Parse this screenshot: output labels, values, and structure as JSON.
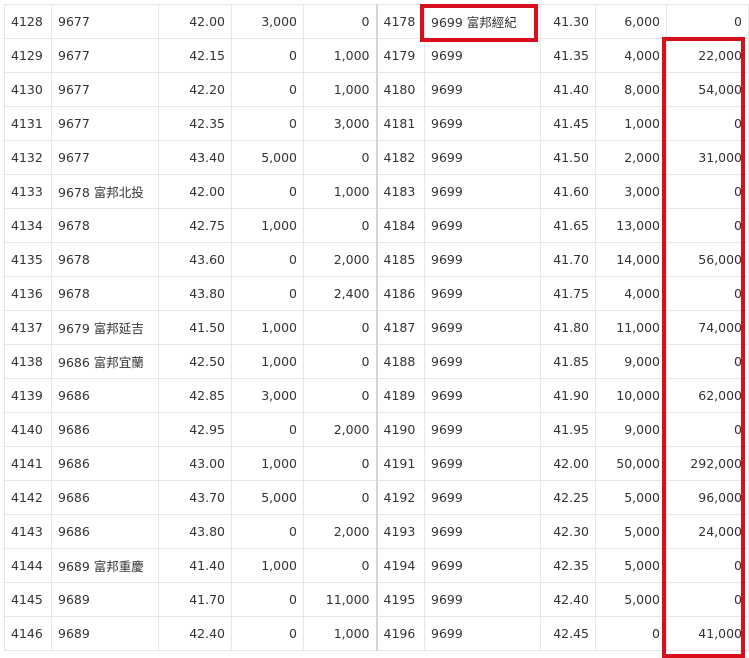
{
  "rows": [
    {
      "l": [
        "4128",
        "9677",
        "42.00",
        "3,000",
        "0"
      ],
      "r": [
        "4178",
        "9699 富邦經紀",
        "41.30",
        "6,000",
        "0"
      ]
    },
    {
      "l": [
        "4129",
        "9677",
        "42.15",
        "0",
        "1,000"
      ],
      "r": [
        "4179",
        "9699",
        "41.35",
        "4,000",
        "22,000"
      ]
    },
    {
      "l": [
        "4130",
        "9677",
        "42.20",
        "0",
        "1,000"
      ],
      "r": [
        "4180",
        "9699",
        "41.40",
        "8,000",
        "54,000"
      ]
    },
    {
      "l": [
        "4131",
        "9677",
        "42.35",
        "0",
        "3,000"
      ],
      "r": [
        "4181",
        "9699",
        "41.45",
        "1,000",
        "0"
      ]
    },
    {
      "l": [
        "4132",
        "9677",
        "43.40",
        "5,000",
        "0"
      ],
      "r": [
        "4182",
        "9699",
        "41.50",
        "2,000",
        "31,000"
      ]
    },
    {
      "l": [
        "4133",
        "9678 富邦北投",
        "42.00",
        "0",
        "1,000"
      ],
      "r": [
        "4183",
        "9699",
        "41.60",
        "3,000",
        "0"
      ]
    },
    {
      "l": [
        "4134",
        "9678",
        "42.75",
        "1,000",
        "0"
      ],
      "r": [
        "4184",
        "9699",
        "41.65",
        "13,000",
        "0"
      ]
    },
    {
      "l": [
        "4135",
        "9678",
        "43.60",
        "0",
        "2,000"
      ],
      "r": [
        "4185",
        "9699",
        "41.70",
        "14,000",
        "56,000"
      ]
    },
    {
      "l": [
        "4136",
        "9678",
        "43.80",
        "0",
        "2,400"
      ],
      "r": [
        "4186",
        "9699",
        "41.75",
        "4,000",
        "0"
      ]
    },
    {
      "l": [
        "4137",
        "9679 富邦延吉",
        "41.50",
        "1,000",
        "0"
      ],
      "r": [
        "4187",
        "9699",
        "41.80",
        "11,000",
        "74,000"
      ]
    },
    {
      "l": [
        "4138",
        "9686 富邦宜蘭",
        "42.50",
        "1,000",
        "0"
      ],
      "r": [
        "4188",
        "9699",
        "41.85",
        "9,000",
        "0"
      ]
    },
    {
      "l": [
        "4139",
        "9686",
        "42.85",
        "3,000",
        "0"
      ],
      "r": [
        "4189",
        "9699",
        "41.90",
        "10,000",
        "62,000"
      ]
    },
    {
      "l": [
        "4140",
        "9686",
        "42.95",
        "0",
        "2,000"
      ],
      "r": [
        "4190",
        "9699",
        "41.95",
        "9,000",
        "0"
      ]
    },
    {
      "l": [
        "4141",
        "9686",
        "43.00",
        "1,000",
        "0"
      ],
      "r": [
        "4191",
        "9699",
        "42.00",
        "50,000",
        "292,000"
      ]
    },
    {
      "l": [
        "4142",
        "9686",
        "43.70",
        "5,000",
        "0"
      ],
      "r": [
        "4192",
        "9699",
        "42.25",
        "5,000",
        "96,000"
      ]
    },
    {
      "l": [
        "4143",
        "9686",
        "43.80",
        "0",
        "2,000"
      ],
      "r": [
        "4193",
        "9699",
        "42.30",
        "5,000",
        "24,000"
      ]
    },
    {
      "l": [
        "4144",
        "9689 富邦重慶",
        "41.40",
        "1,000",
        "0"
      ],
      "r": [
        "4194",
        "9699",
        "42.35",
        "5,000",
        "0"
      ]
    },
    {
      "l": [
        "4145",
        "9689",
        "41.70",
        "0",
        "11,000"
      ],
      "r": [
        "4195",
        "9699",
        "42.40",
        "5,000",
        "0"
      ]
    },
    {
      "l": [
        "4146",
        "9689",
        "42.40",
        "0",
        "1,000"
      ],
      "r": [
        "4196",
        "9699",
        "42.45",
        "0",
        "41,000"
      ]
    }
  ],
  "highlight_color": "#d80f1c"
}
